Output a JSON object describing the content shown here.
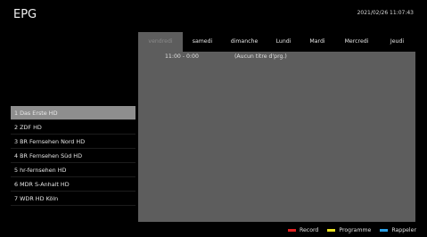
{
  "header": {
    "title": "EPG",
    "datetime": "2021/02/26 11:07:43"
  },
  "days": [
    {
      "label": "vendredi",
      "active": true
    },
    {
      "label": "samedi",
      "active": false
    },
    {
      "label": "dimanche",
      "active": false
    },
    {
      "label": "Lundi",
      "active": false
    },
    {
      "label": "Mardi",
      "active": false
    },
    {
      "label": "Mercredi",
      "active": false
    },
    {
      "label": "Jeudi",
      "active": false
    }
  ],
  "channels": [
    {
      "label": "1 Das Erste HD",
      "selected": true
    },
    {
      "label": "2 ZDF HD",
      "selected": false
    },
    {
      "label": "3 BR Fernsehen Nord HD",
      "selected": false
    },
    {
      "label": "4 BR Fernsehen Süd HD",
      "selected": false
    },
    {
      "label": "5 hr-fernsehen HD",
      "selected": false
    },
    {
      "label": "6 MDR S-Anhalt HD",
      "selected": false
    },
    {
      "label": "7 WDR HD Köln",
      "selected": false
    }
  ],
  "program": {
    "time": "11:00 - 0:00",
    "name": "(Aucun titre d'prg.)"
  },
  "footer": {
    "record": {
      "label": "Record",
      "color": "#e02020"
    },
    "programme": {
      "label": "Programme",
      "color": "#e8e020"
    },
    "rappeler": {
      "label": "Rappeler",
      "color": "#2aa0e6"
    }
  },
  "colors": {
    "background": "#000000",
    "panel": "#5d5d5d",
    "selected_row": "#8e8e8e"
  }
}
